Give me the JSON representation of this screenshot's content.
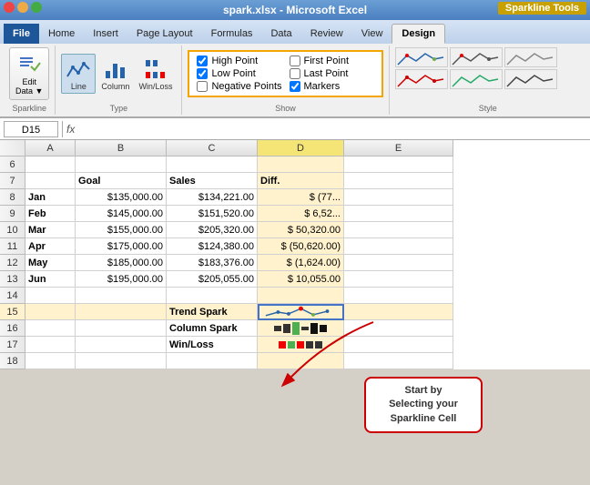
{
  "titleBar": {
    "text": "spark.xlsx - Microsoft Excel"
  },
  "sparklineToolsLabel": "Sparkline Tools",
  "ribbonTabs": [
    {
      "label": "File",
      "active": false
    },
    {
      "label": "Home",
      "active": false
    },
    {
      "label": "Insert",
      "active": false
    },
    {
      "label": "Page Layout",
      "active": false
    },
    {
      "label": "Formulas",
      "active": false
    },
    {
      "label": "Data",
      "active": false
    },
    {
      "label": "Review",
      "active": false
    },
    {
      "label": "View",
      "active": false
    },
    {
      "label": "Design",
      "active": true
    }
  ],
  "sparklineGroup": {
    "label": "Sparkline",
    "editDataLabel": "Edit\nData ▼"
  },
  "typeGroup": {
    "label": "Type",
    "buttons": [
      {
        "label": "Line",
        "active": true
      },
      {
        "label": "Column",
        "active": false
      },
      {
        "label": "Win/Loss",
        "active": false
      }
    ]
  },
  "showGroup": {
    "label": "Show",
    "items": [
      {
        "label": "High Point",
        "checked": true
      },
      {
        "label": "First Point",
        "checked": false
      },
      {
        "label": "Low Point",
        "checked": true
      },
      {
        "label": "Last Point",
        "checked": false
      },
      {
        "label": "Negative Points",
        "checked": false
      },
      {
        "label": "Markers",
        "checked": true
      }
    ]
  },
  "styleGroup": {
    "label": "Style"
  },
  "formulaBar": {
    "cellRef": "D15",
    "fx": "fx"
  },
  "columns": [
    {
      "label": "",
      "class": "col-a"
    },
    {
      "label": "A",
      "class": "col-a"
    },
    {
      "label": "B",
      "class": "col-b"
    },
    {
      "label": "C",
      "class": "col-c"
    },
    {
      "label": "D",
      "class": "col-d"
    },
    {
      "label": "E",
      "class": "col-e"
    }
  ],
  "rows": [
    {
      "num": "6",
      "cells": [
        "",
        "",
        "",
        "",
        ""
      ]
    },
    {
      "num": "7",
      "cells": [
        "",
        "Goal",
        "Sales",
        "Diff.",
        ""
      ]
    },
    {
      "num": "8",
      "cells": [
        "Jan",
        "$135,000.00",
        "$134,221.00",
        "$ (77...",
        ""
      ]
    },
    {
      "num": "9",
      "cells": [
        "Feb",
        "$145,000.00",
        "$151,520.00",
        "$  6,52...",
        ""
      ]
    },
    {
      "num": "10",
      "cells": [
        "Mar",
        "$155,000.00",
        "$205,320.00",
        "$  50,320.00",
        ""
      ]
    },
    {
      "num": "11",
      "cells": [
        "Apr",
        "$175,000.00",
        "$124,380.00",
        "$ (50,620.00)",
        ""
      ]
    },
    {
      "num": "12",
      "cells": [
        "May",
        "$185,000.00",
        "$183,376.00",
        "$  (1,624.00)",
        ""
      ]
    },
    {
      "num": "13",
      "cells": [
        "Jun",
        "$195,000.00",
        "$205,055.00",
        "$  10,055.00",
        ""
      ]
    },
    {
      "num": "14",
      "cells": [
        "",
        "",
        "",
        "",
        ""
      ]
    },
    {
      "num": "15",
      "cells": [
        "",
        "",
        "Trend Spark",
        "",
        ""
      ]
    },
    {
      "num": "16",
      "cells": [
        "",
        "",
        "Column Spark",
        "",
        ""
      ]
    },
    {
      "num": "17",
      "cells": [
        "",
        "",
        "Win/Loss",
        "",
        ""
      ]
    },
    {
      "num": "18",
      "cells": [
        "",
        "",
        "",
        "",
        ""
      ]
    }
  ],
  "callout": {
    "text": "Start by\nSelecting your\nSparkline Cell"
  }
}
